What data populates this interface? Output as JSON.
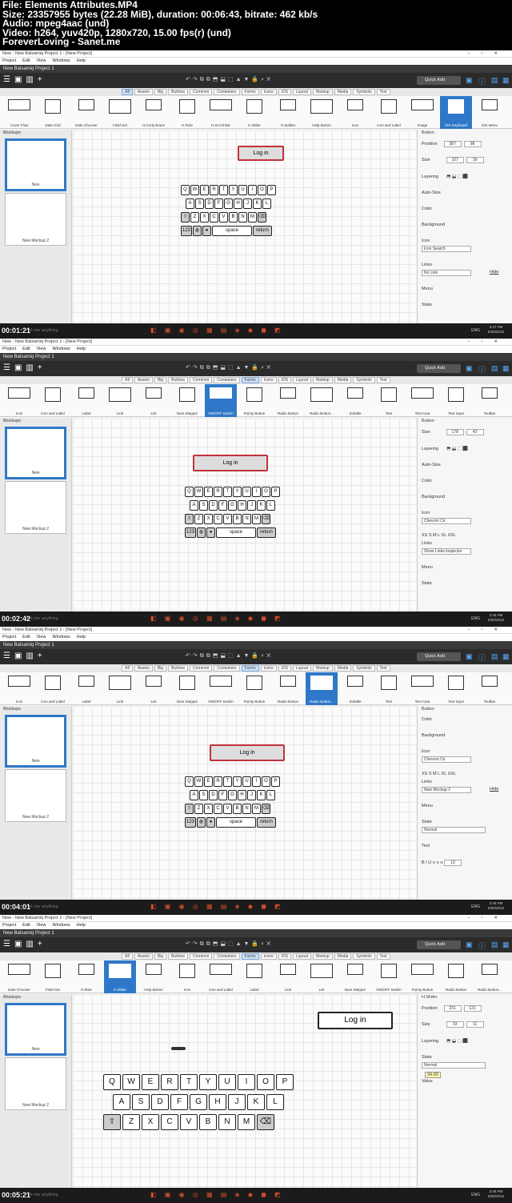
{
  "header": {
    "line1": "File: Elements Attributes.MP4",
    "line2": "Size: 23357955 bytes (22.28 MiB), duration: 00:06:43, bitrate: 462 kb/s",
    "line3": "Audio: mpeg4aac (und)",
    "line4": "Video: h264, yuv420p, 1280x720, 15.00 fps(r) (und)",
    "line5": "ForeverLoving - Sanet.me"
  },
  "app": {
    "window_title": "New - New Balsamiq Project 1 - [New Project]",
    "menu": [
      "Project",
      "Edit",
      "View",
      "Windows",
      "Help"
    ],
    "project_name": "New Balsamiq Project 1",
    "quick_add": "Quick Add",
    "category_tabs": [
      "All",
      "Assets",
      "Big",
      "Buttons",
      "Common",
      "Containers",
      "Forms",
      "Icons",
      "iOS",
      "Layout",
      "Markup",
      "Media",
      "Symbols",
      "Text"
    ],
    "mockups_label": "Mockups",
    "mockup_names": [
      "New",
      "New Mockup 2"
    ],
    "search_hint": "Ask me anything",
    "lang": "ENG"
  },
  "frames": [
    {
      "timestamp": "00:01:21",
      "clock_time": "3:37 PM",
      "clock_date": "8/30/2016",
      "active_tab": "All",
      "library": [
        "Cover Flow",
        "Data Grid",
        "Date Chooser",
        "Field Set",
        "H.Curly Brace",
        "H.Rule",
        "H.Scroll Bar",
        "H.Slider",
        "H.Splitter",
        "Help Button",
        "Icon",
        "Icon and Label",
        "Image",
        "iOS Keyboard",
        "iOS Menu"
      ],
      "selected_library": "iOS Keyboard",
      "button_text": "Log in",
      "props_title": "Button",
      "position_label": "Position",
      "position_x": "387",
      "position_y": "98",
      "size_label": "Size",
      "size_w": "107",
      "size_h": "39",
      "props_labels": [
        "Layering",
        "Auto-Size",
        "Color",
        "Background",
        "Icon",
        "Links",
        "Menu",
        "State"
      ],
      "icon_search": "Icon Search",
      "link_value": "No Link",
      "hide_label": "Hide"
    },
    {
      "timestamp": "00:02:42",
      "clock_time": "3:45 PM",
      "clock_date": "8/30/2016",
      "active_tab": "Forms",
      "library": [
        "Icon",
        "Icon and Label",
        "Label",
        "Link",
        "List",
        "Num.Stepper",
        "ON/OFF Switch",
        "Pointy Button",
        "Radio Button",
        "Radio Button...",
        "Subtitle",
        "Text",
        "Text Area",
        "Text Input",
        "Toolbar"
      ],
      "selected_library": "ON/OFF Switch",
      "button_text": "Log in",
      "props_title": "Button",
      "size_label": "Size",
      "size_w": "178",
      "size_h": "42",
      "props_labels": [
        "Layering",
        "Auto-Size",
        "Color",
        "Background",
        "Icon",
        "Links",
        "Menu",
        "State"
      ],
      "icon_value": "Chevron Cir",
      "icon_sizes": "XS S M L XL XXL",
      "link_value": "Show Links Inspector"
    },
    {
      "timestamp": "00:04:01",
      "clock_time": "3:46 PM",
      "clock_date": "8/30/2016",
      "active_tab": "Forms",
      "library": [
        "Icon",
        "Icon and Label",
        "Label",
        "Link",
        "List",
        "Num.Stepper",
        "ON/OFF Switch",
        "Pointy Button",
        "Radio Button",
        "Radio Button...",
        "Subtitle",
        "Text",
        "Text Area",
        "Text Input",
        "Toolbar"
      ],
      "selected_library": "Radio Button...",
      "button_text": "Log in",
      "props_title": "Button",
      "props_labels": [
        "Color",
        "Background",
        "Icon",
        "Links",
        "Menu",
        "State",
        "Text"
      ],
      "icon_value": "Chevron Cir",
      "icon_sizes": "XS S M L XL XXL",
      "link_value": "New Mockup 2",
      "hide_label": "Hide",
      "state_value": "Normal",
      "font_size": "13"
    },
    {
      "timestamp": "00:05:21",
      "clock_time": "3:48 PM",
      "clock_date": "8/30/2016",
      "active_tab": "Forms",
      "library": [
        "Date Chooser",
        "Field Set",
        "H.Rule",
        "H.Slider",
        "Help Button",
        "Icon",
        "Icon and Label",
        "Label",
        "Link",
        "List",
        "Num.Stepper",
        "ON/OFF Switch",
        "Pointy Button",
        "Radio Button",
        "Radio Button..."
      ],
      "selected_library": "H.Slider",
      "button_text": "Log in",
      "props_title": "H.Slider",
      "position_label": "Position",
      "position_x": "231",
      "position_y": "121",
      "size_label": "Size",
      "size_w": "33",
      "size_h": "11",
      "props_labels": [
        "Layering",
        "State",
        "Value"
      ],
      "state_value": "Normal",
      "tooltip_value": "34.00"
    }
  ],
  "keyboard": {
    "row1": [
      "Q",
      "W",
      "E",
      "R",
      "T",
      "Y",
      "U",
      "I",
      "O",
      "P"
    ],
    "row2": [
      "A",
      "S",
      "D",
      "F",
      "G",
      "H",
      "J",
      "K",
      "L"
    ],
    "row3": [
      "Z",
      "X",
      "C",
      "V",
      "B",
      "N",
      "M"
    ],
    "space": "space",
    "return": "return",
    "num": "123"
  }
}
